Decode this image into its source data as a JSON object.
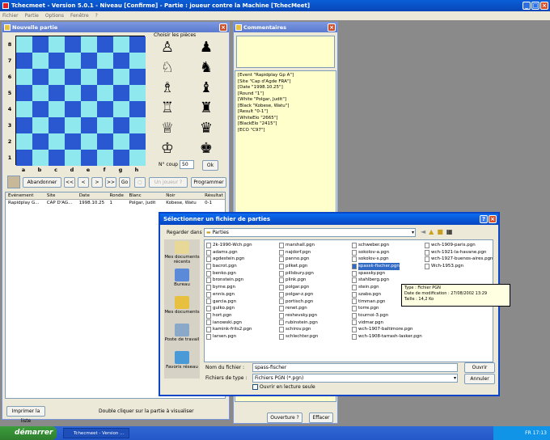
{
  "app": {
    "title": "Tchecmeet - Version 5.0.1 - Niveau [Confirme] - Partie : joueur contre la Machine [TchecMeet]",
    "menu": [
      "Fichier",
      "Partie",
      "Options",
      "Fenêtre",
      "?"
    ]
  },
  "game_window": {
    "title": "Nouvelle partie",
    "choose_pieces": "Choisir les pièces",
    "ranks": [
      "8",
      "7",
      "6",
      "5",
      "4",
      "3",
      "2",
      "1"
    ],
    "files": [
      "a",
      "b",
      "c",
      "d",
      "e",
      "f",
      "g",
      "h"
    ],
    "pieces": [
      [
        "♙",
        "♟"
      ],
      [
        "♘",
        "♞"
      ],
      [
        "♗",
        "♝"
      ],
      [
        "♖",
        "♜"
      ],
      [
        "♕",
        "♛"
      ],
      [
        "♔",
        "♚"
      ]
    ],
    "coup_label": "N° coup",
    "coup_value": "50",
    "ok": "Ok",
    "buttons": {
      "abandon": "Abandonner",
      "first": "<<",
      "prev": "<",
      "next": ">",
      "last": ">>",
      "go": "Go",
      "undo": "Un joueur ?",
      "program": "Programmer"
    },
    "table": {
      "headers": [
        "Evénement",
        "Site",
        "Date",
        "Ronde",
        "Blanc",
        "Noir",
        "Résultat"
      ],
      "rows": [
        [
          "Rapidplay G...",
          "CAP D'AG...",
          "1998.10.25",
          "1",
          "Polgar, Judit",
          "Kobese, Watu",
          "0-1"
        ]
      ]
    },
    "print": "Imprimer la liste",
    "hint": "Double cliquer sur la partie à visualiser"
  },
  "comments_window": {
    "title": "Commentaires",
    "pgn": [
      "[Event \"Rapidplay Gp A\"]",
      "[Site \"Cap d'Agde FRA\"]",
      "[Date \"1998.10.25\"]",
      "[Round \"1\"]",
      "[White \"Polgar, Judit\"]",
      "[Black \"Kobese, Watu\"]",
      "[Result \"0-1\"]",
      "[WhiteElo \"2665\"]",
      "[BlackElo \"2415\"]",
      "[ECO \"C97\"]"
    ],
    "open": "Ouverture ?",
    "clear": "Effacer"
  },
  "dialog": {
    "title": "Sélectionner un fichier de parties",
    "lookin_label": "Regarder dans :",
    "lookin_value": "Parties",
    "places": [
      "Mes documents récents",
      "Bureau",
      "Mes documents",
      "Poste de travail",
      "Favoris réseau"
    ],
    "columns": [
      [
        "2k-1990-Wch.pgn",
        "adams.pgn",
        "agdestein.pgn",
        "bacrot.pgn",
        "benko.pgn",
        "bronstein.pgn",
        "byrne.pgn",
        "ennis.pgn",
        "garcia.pgn",
        "gulko.pgn",
        "hort.pgn",
        "ianowski.pgn",
        "kamink-frits2.pgn",
        "larsen.pgn"
      ],
      [
        "marshall.pgn",
        "najdorf.pgn",
        "panno.pgn",
        "pilket.pgn",
        "pillsbury.pgn",
        "plink.pgn",
        "polgar.pgn",
        "polgar-z.pgn",
        "portisch.pgn",
        "renet.pgn",
        "reshevsky.pgn",
        "rubinstein.pgn",
        "schirov.pgn",
        "schlechter.pgn"
      ],
      [
        "schweber.pgn",
        "sokolov-a.pgn",
        "sokolov-s.pgn",
        "spassk-fischer.pgn",
        "spassky.pgn",
        "stahlberg.pgn",
        "stein.pgn",
        "szabo.pgn",
        "timman.pgn",
        "torre.pgn",
        "tournoi-3.pgn",
        "vidmar.pgn",
        "wch-1907-baltimore.pgn",
        "wch-1908-tarrash-lasker.pgn"
      ],
      [
        "wch-1909-paris.pgn",
        "wch-1921-la-havane.pgn",
        "wch-1927-buenos-aires.pgn",
        "Wch-1953.pgn"
      ]
    ],
    "selected": "spassk-fischer.pgn",
    "tooltip": [
      "Type : Fichier PGN",
      "Date de modification : 27/08/2002 13:29",
      "Taille : 14,2 Ko"
    ],
    "filename_label": "Nom du fichier :",
    "filename_value": "spass-fischer",
    "filetype_label": "Fichiers de type :",
    "filetype_value": "Fichiers PGN (*.pgn)",
    "readonly": "Ouvrir en lecture seule",
    "open": "Ouvrir",
    "cancel": "Annuler"
  },
  "taskbar": {
    "start": "démarrer",
    "item": "Tchecmeet - Version ...",
    "lang": "FR",
    "time": "17:13"
  }
}
